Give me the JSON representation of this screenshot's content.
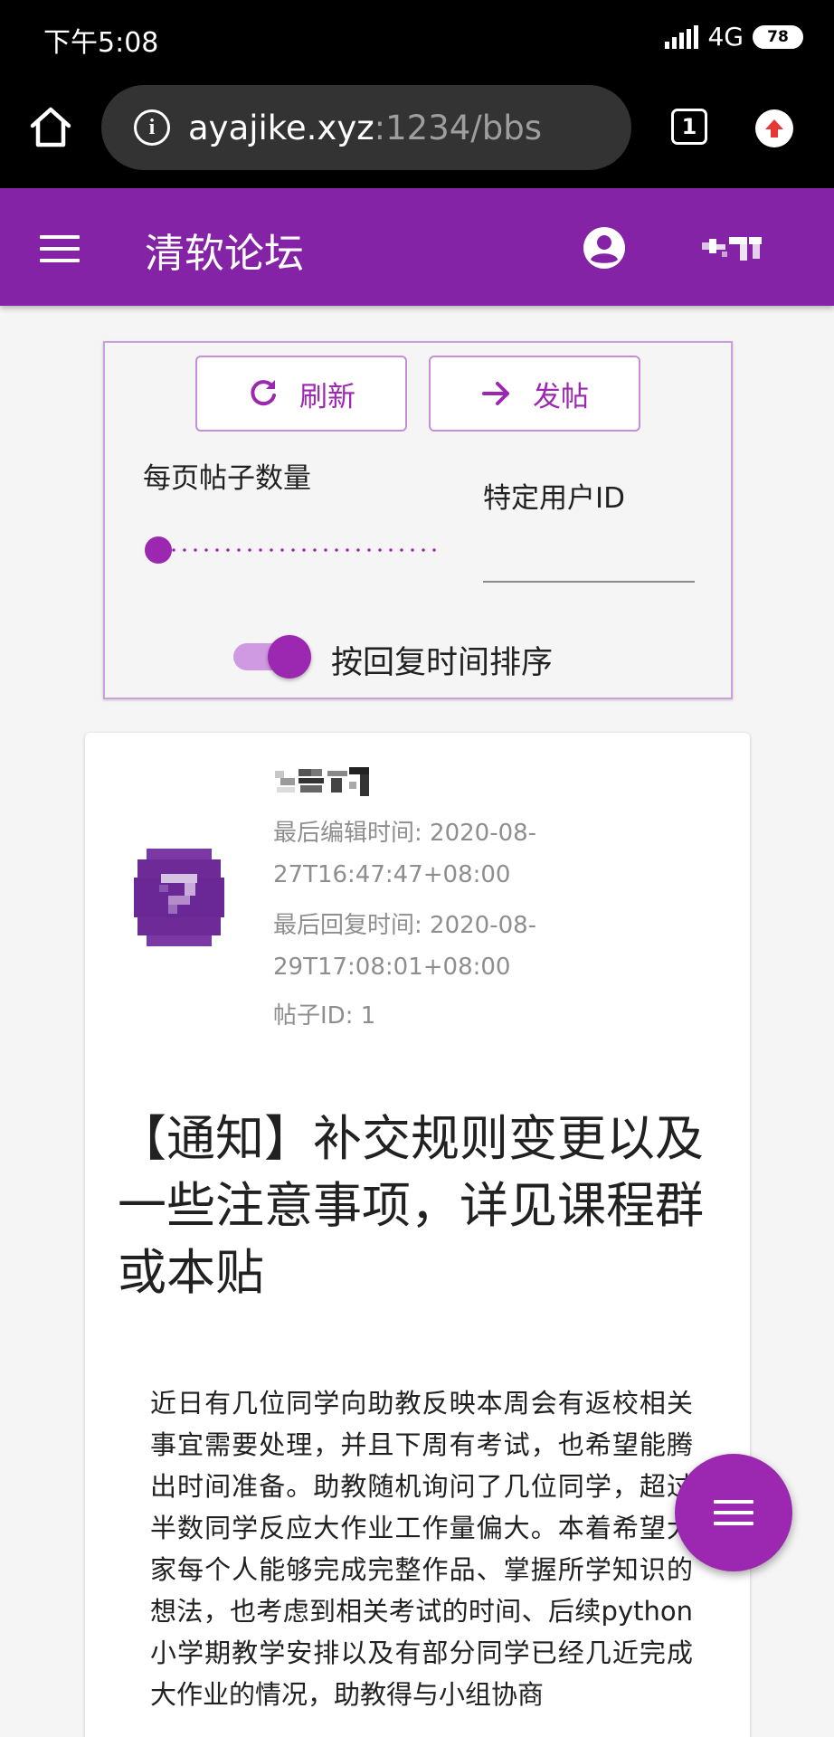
{
  "status_bar": {
    "time": "下午5:08",
    "network": "4G",
    "battery": "78"
  },
  "browser": {
    "url_host": "ayajike.xyz",
    "url_rest": ":1234/bbs",
    "tab_count": "1"
  },
  "app_bar": {
    "title": "清软论坛"
  },
  "controls": {
    "refresh_label": "刷新",
    "post_label": "发帖",
    "per_page_label": "每页帖子数量",
    "per_page_slider_fraction": 0.0,
    "user_id_label": "特定用户ID",
    "user_id_value": "",
    "sort_label": "按回复时间排序",
    "sort_by_reply_enabled": true
  },
  "post": {
    "last_edit": "最后编辑时间: 2020-08-27T16:47:47+08:00",
    "last_reply": "最后回复时间: 2020-08-29T17:08:01+08:00",
    "post_id": "帖子ID: 1",
    "title": "【通知】补交规则变更以及一些注意事项，详见课程群或本贴",
    "body": "近日有几位同学向助教反映本周会有返校相关事宜需要处理，并且下周有考试，也希望能腾出时间准备。助教随机询问了几位同学，超过半数同学反应大作业工作量偏大。本着希望大家每个人能够完成完整作品、掌握所学知识的想法，也考虑到相关考试的时间、后续python小学期教学安排以及有部分同学已经几近完成大作业的情况，助教得与小组协商"
  },
  "colors": {
    "primary": "#8423a6",
    "accent": "#9c27b0"
  },
  "icons": [
    "home-icon",
    "info-icon",
    "tabs-icon",
    "update-icon",
    "menu-icon",
    "account-icon",
    "refresh-icon",
    "arrow-right-icon",
    "fab-menu-icon"
  ]
}
